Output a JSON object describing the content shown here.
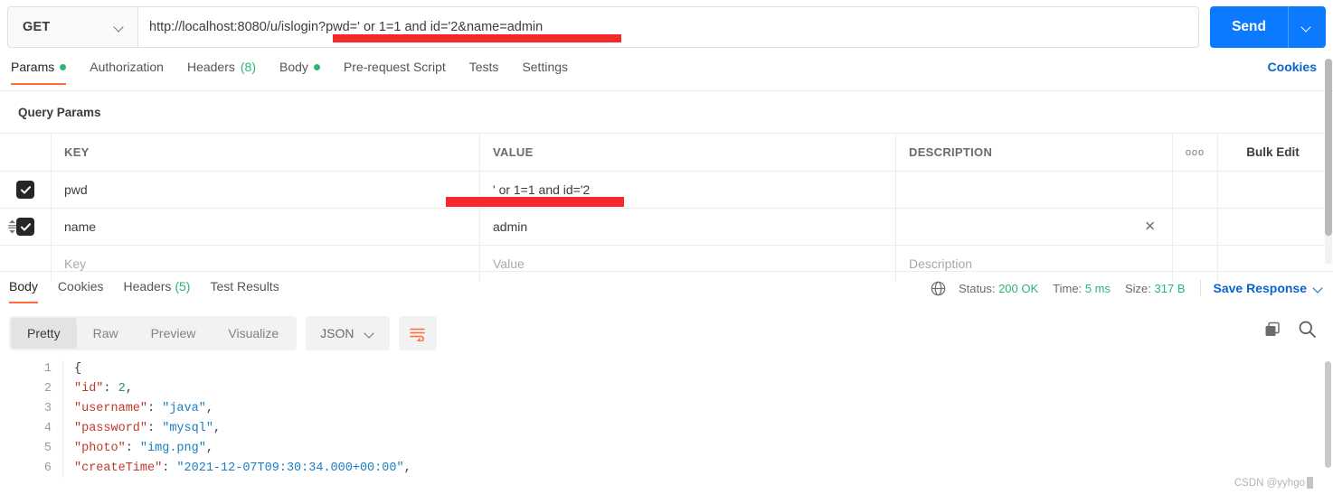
{
  "request": {
    "method": "GET",
    "url": "http://localhost:8080/u/islogin?pwd=' or 1=1 and id='2&name=admin",
    "send_label": "Send",
    "send_caret_icon": "chevron-down-icon",
    "method_caret_icon": "chevron-down-icon"
  },
  "request_tabs": [
    {
      "label": "Params",
      "badge": "dot",
      "active": true
    },
    {
      "label": "Authorization",
      "badge": "",
      "active": false
    },
    {
      "label": "Headers",
      "count": "(8)",
      "badge": "count",
      "active": false
    },
    {
      "label": "Body",
      "badge": "dot",
      "active": false
    },
    {
      "label": "Pre-request Script",
      "badge": "",
      "active": false
    },
    {
      "label": "Tests",
      "badge": "",
      "active": false
    },
    {
      "label": "Settings",
      "badge": "",
      "active": false
    }
  ],
  "cookies_link": "Cookies",
  "params": {
    "section_title": "Query Params",
    "columns": [
      "KEY",
      "VALUE",
      "DESCRIPTION"
    ],
    "dots_label": "ooo",
    "bulk_edit_label": "Bulk Edit",
    "rows": [
      {
        "checked": true,
        "key": "pwd",
        "value": "' or 1=1 and id='2",
        "description": ""
      },
      {
        "checked": true,
        "key": "name",
        "value": "admin",
        "description": ""
      }
    ],
    "placeholder_row": {
      "key": "Key",
      "value": "Value",
      "description": "Description"
    }
  },
  "response_tabs": [
    {
      "label": "Body",
      "active": true
    },
    {
      "label": "Cookies",
      "active": false
    },
    {
      "label": "Headers",
      "count": "(5)",
      "active": false
    },
    {
      "label": "Test Results",
      "active": false
    }
  ],
  "response_meta": {
    "globe_icon": "globe-icon",
    "status_label": "Status:",
    "status_value": "200 OK",
    "time_label": "Time:",
    "time_value": "5 ms",
    "size_label": "Size:",
    "size_value": "317 B",
    "save_response_label": "Save Response"
  },
  "format_bar": {
    "views": [
      {
        "label": "Pretty",
        "active": true
      },
      {
        "label": "Raw",
        "active": false
      },
      {
        "label": "Preview",
        "active": false
      },
      {
        "label": "Visualize",
        "active": false
      }
    ],
    "language": "JSON",
    "wrap_icon": "word-wrap-icon",
    "copy_icon": "copy-icon",
    "search_icon": "search-icon"
  },
  "response_body": {
    "line_numbers": [
      "1",
      "2",
      "3",
      "4",
      "5",
      "6"
    ],
    "lines": [
      {
        "tokens": [
          {
            "t": "{",
            "c": "p"
          }
        ]
      },
      {
        "indent": 4,
        "tokens": [
          {
            "t": "\"id\"",
            "c": "k"
          },
          {
            "t": ": ",
            "c": "p"
          },
          {
            "t": "2",
            "c": "n"
          },
          {
            "t": ",",
            "c": "p"
          }
        ]
      },
      {
        "indent": 4,
        "tokens": [
          {
            "t": "\"username\"",
            "c": "k"
          },
          {
            "t": ": ",
            "c": "p"
          },
          {
            "t": "\"java\"",
            "c": "s"
          },
          {
            "t": ",",
            "c": "p"
          }
        ]
      },
      {
        "indent": 4,
        "tokens": [
          {
            "t": "\"password\"",
            "c": "k"
          },
          {
            "t": ": ",
            "c": "p"
          },
          {
            "t": "\"mysql\"",
            "c": "s"
          },
          {
            "t": ",",
            "c": "p"
          }
        ]
      },
      {
        "indent": 4,
        "tokens": [
          {
            "t": "\"photo\"",
            "c": "k"
          },
          {
            "t": ": ",
            "c": "p"
          },
          {
            "t": "\"img.png\"",
            "c": "s"
          },
          {
            "t": ",",
            "c": "p"
          }
        ]
      },
      {
        "indent": 4,
        "tokens": [
          {
            "t": "\"createTime\"",
            "c": "k"
          },
          {
            "t": ": ",
            "c": "p"
          },
          {
            "t": "\"2021-12-07T09:30:34.000+00:00\"",
            "c": "s"
          },
          {
            "t": ",",
            "c": "p"
          }
        ]
      }
    ]
  },
  "watermark": "CSDN @yyhgo",
  "colors": {
    "accent_orange": "#ff6c37",
    "send_blue": "#0b7aff",
    "link_blue": "#0b63ce",
    "status_green": "#2bb673",
    "redaction_red": "#f5282b"
  }
}
